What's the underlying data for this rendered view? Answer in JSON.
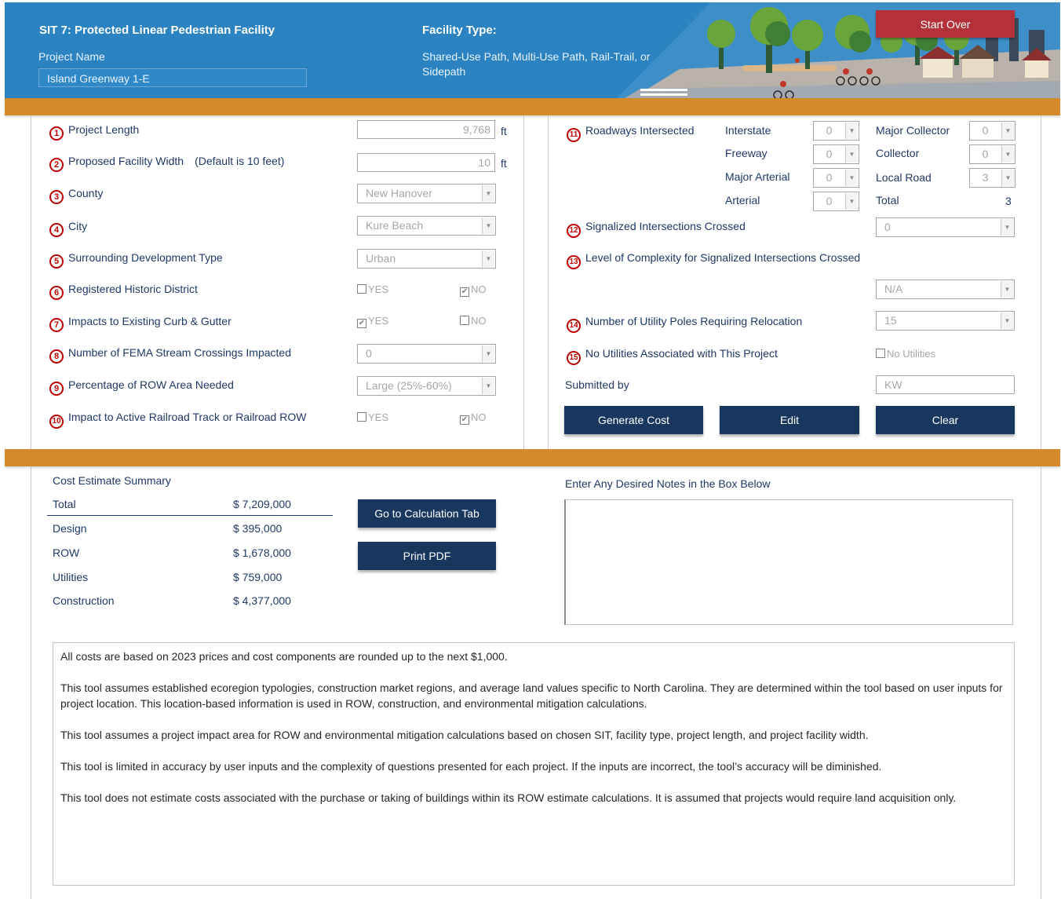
{
  "header": {
    "title": "SIT 7: Protected Linear Pedestrian Facility",
    "project_name_label": "Project Name",
    "project_name_value": "Island Greenway 1-E",
    "facility_type_label": "Facility Type:",
    "facility_type_value": "Shared-Use Path, Multi-Use Path, Rail-Trail, or Sidepath",
    "start_over_label": "Start Over"
  },
  "left_questions": {
    "q1": {
      "num": "1",
      "label": "Project Length",
      "value": "9,768",
      "unit": "ft"
    },
    "q2": {
      "num": "2",
      "label": "Proposed Facility Width",
      "note": "(Default is 10 feet)",
      "value": "10",
      "unit": "ft"
    },
    "q3": {
      "num": "3",
      "label": "County",
      "value": "New Hanover"
    },
    "q4": {
      "num": "4",
      "label": "City",
      "value": "Kure Beach"
    },
    "q5": {
      "num": "5",
      "label": "Surrounding Development Type",
      "value": "Urban"
    },
    "q6": {
      "num": "6",
      "label": "Registered Historic District",
      "yes": "YES",
      "no": "NO",
      "yes_checked": false,
      "no_checked": true
    },
    "q7": {
      "num": "7",
      "label": "Impacts to Existing Curb & Gutter",
      "yes": "YES",
      "no": "NO",
      "yes_checked": true,
      "no_checked": false
    },
    "q8": {
      "num": "8",
      "label": "Number of FEMA Stream Crossings Impacted",
      "value": "0"
    },
    "q9": {
      "num": "9",
      "label": "Percentage of ROW Area Needed",
      "value": "Large (25%-60%)"
    },
    "q10": {
      "num": "10",
      "label": "Impact to Active Railroad Track or Railroad ROW",
      "yes": "YES",
      "no": "NO",
      "yes_checked": false,
      "no_checked": true
    }
  },
  "right_questions": {
    "q11": {
      "num": "11",
      "label": "Roadways Intersected",
      "interstate_label": "Interstate",
      "interstate_value": "0",
      "freeway_label": "Freeway",
      "freeway_value": "0",
      "major_arterial_label": "Major Arterial",
      "major_arterial_value": "0",
      "arterial_label": "Arterial",
      "arterial_value": "0",
      "major_collector_label": "Major Collector",
      "major_collector_value": "0",
      "collector_label": "Collector",
      "collector_value": "0",
      "local_road_label": "Local Road",
      "local_road_value": "3",
      "total_label": "Total",
      "total_value": "3"
    },
    "q12": {
      "num": "12",
      "label": "Signalized Intersections Crossed",
      "value": "0"
    },
    "q13": {
      "num": "13",
      "label": "Level of Complexity for Signalized Intersections Crossed",
      "value": "N/A"
    },
    "q14": {
      "num": "14",
      "label": "Number of Utility Poles Requiring Relocation",
      "value": "15"
    },
    "q15": {
      "num": "15",
      "label": "No Utilities Associated with This Project",
      "checkbox_label": "No Utilities",
      "checked": false
    },
    "submitted_by_label": "Submitted by",
    "submitted_by_value": "KW"
  },
  "actions": {
    "generate_cost": "Generate Cost",
    "edit": "Edit",
    "clear": "Clear",
    "go_to_calc": "Go to Calculation Tab",
    "print_pdf": "Print PDF"
  },
  "summary": {
    "title": "Cost Estimate Summary",
    "rows": [
      {
        "label": "Total",
        "value": "$ 7,209,000"
      },
      {
        "label": "Design",
        "value": "$ 395,000"
      },
      {
        "label": "ROW",
        "value": "$ 1,678,000"
      },
      {
        "label": "Utilities",
        "value": "$ 759,000"
      },
      {
        "label": "Construction",
        "value": "$ 4,377,000"
      }
    ]
  },
  "notes": {
    "label": "Enter Any Desired Notes in the Box Below",
    "value": ""
  },
  "info": {
    "paragraphs": [
      "All costs are based on 2023 prices and cost components are rounded up to the next $1,000.",
      "This tool assumes established ecoregion typologies, construction market regions, and average land values specific to North Carolina. They are determined within the tool based on user inputs for project location. This location-based information is used in ROW, construction, and environmental mitigation calculations.",
      "This tool assumes a project impact area for ROW and environmental mitigation calculations based on chosen SIT, facility type, project length, and project facility width.",
      "This tool is limited in accuracy by user inputs and the complexity of questions presented for each project. If the inputs are incorrect, the tool’s accuracy will be diminished.",
      "This tool does not estimate costs associated with the purchase or taking of buildings within its ROW estimate calculations. It is assumed that projects would require land acquisition only."
    ]
  },
  "colors": {
    "header_blue": "#2b83c1",
    "accent_orange": "#d48a2a",
    "button_navy": "#17375e",
    "start_over_red": "#b5313a",
    "number_red": "#c00000",
    "text_navy": "#1f3864"
  },
  "icons": {
    "header_scene": "street-scene-illustration",
    "dropdown": "chevron-down-icon",
    "checkbox": "checkbox-icon"
  }
}
